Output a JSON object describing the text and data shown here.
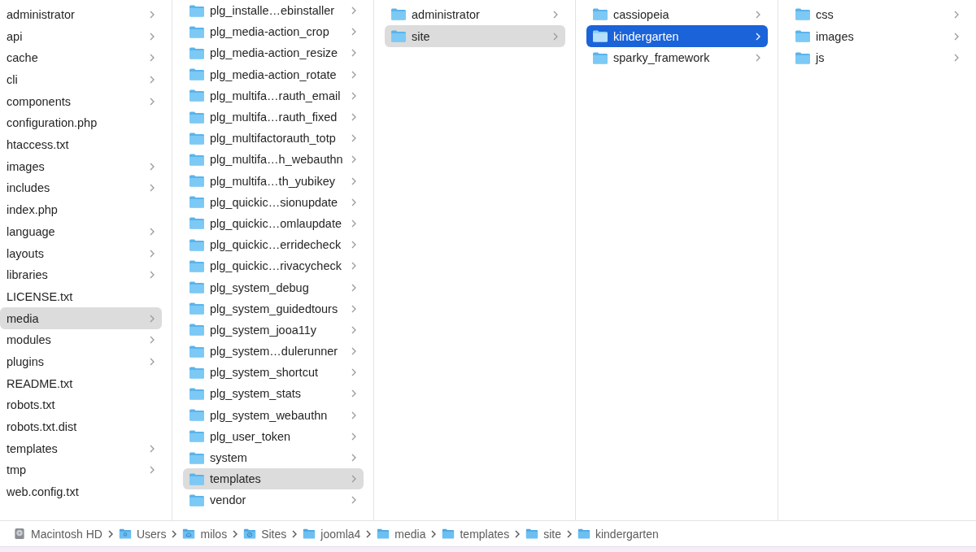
{
  "columns": [
    {
      "show_icons": false,
      "active": false,
      "items": [
        {
          "name": "administrator",
          "kind": "folder",
          "selected": false
        },
        {
          "name": "api",
          "kind": "folder",
          "selected": false
        },
        {
          "name": "cache",
          "kind": "folder",
          "selected": false
        },
        {
          "name": "cli",
          "kind": "folder",
          "selected": false
        },
        {
          "name": "components",
          "kind": "folder",
          "selected": false
        },
        {
          "name": "configuration.php",
          "kind": "file",
          "selected": false
        },
        {
          "name": "htaccess.txt",
          "kind": "file",
          "selected": false
        },
        {
          "name": "images",
          "kind": "folder",
          "selected": false
        },
        {
          "name": "includes",
          "kind": "folder",
          "selected": false
        },
        {
          "name": "index.php",
          "kind": "file",
          "selected": false
        },
        {
          "name": "language",
          "kind": "folder",
          "selected": false
        },
        {
          "name": "layouts",
          "kind": "folder",
          "selected": false
        },
        {
          "name": "libraries",
          "kind": "folder",
          "selected": false
        },
        {
          "name": "LICENSE.txt",
          "kind": "file",
          "selected": false
        },
        {
          "name": "media",
          "kind": "folder",
          "selected": true
        },
        {
          "name": "modules",
          "kind": "folder",
          "selected": false
        },
        {
          "name": "plugins",
          "kind": "folder",
          "selected": false
        },
        {
          "name": "README.txt",
          "kind": "file",
          "selected": false
        },
        {
          "name": "robots.txt",
          "kind": "file",
          "selected": false
        },
        {
          "name": "robots.txt.dist",
          "kind": "file",
          "selected": false
        },
        {
          "name": "templates",
          "kind": "folder",
          "selected": false
        },
        {
          "name": "tmp",
          "kind": "folder",
          "selected": false
        },
        {
          "name": "web.config.txt",
          "kind": "file",
          "selected": false
        }
      ]
    },
    {
      "show_icons": true,
      "active": false,
      "items": [
        {
          "name": "plg_installe…ebinstaller",
          "kind": "folder",
          "selected": false
        },
        {
          "name": "plg_media-action_crop",
          "kind": "folder",
          "selected": false
        },
        {
          "name": "plg_media-action_resize",
          "kind": "folder",
          "selected": false
        },
        {
          "name": "plg_media-action_rotate",
          "kind": "folder",
          "selected": false
        },
        {
          "name": "plg_multifa…rauth_email",
          "kind": "folder",
          "selected": false
        },
        {
          "name": "plg_multifa…rauth_fixed",
          "kind": "folder",
          "selected": false
        },
        {
          "name": "plg_multifactorauth_totp",
          "kind": "folder",
          "selected": false
        },
        {
          "name": "plg_multifa…h_webauthn",
          "kind": "folder",
          "selected": false
        },
        {
          "name": "plg_multifa…th_yubikey",
          "kind": "folder",
          "selected": false
        },
        {
          "name": "plg_quickic…sionupdate",
          "kind": "folder",
          "selected": false
        },
        {
          "name": "plg_quickic…omlaupdate",
          "kind": "folder",
          "selected": false
        },
        {
          "name": "plg_quickic…erridecheck",
          "kind": "folder",
          "selected": false
        },
        {
          "name": "plg_quickic…rivacycheck",
          "kind": "folder",
          "selected": false
        },
        {
          "name": "plg_system_debug",
          "kind": "folder",
          "selected": false
        },
        {
          "name": "plg_system_guidedtours",
          "kind": "folder",
          "selected": false
        },
        {
          "name": "plg_system_jooa11y",
          "kind": "folder",
          "selected": false
        },
        {
          "name": "plg_system…dulerunner",
          "kind": "folder",
          "selected": false
        },
        {
          "name": "plg_system_shortcut",
          "kind": "folder",
          "selected": false
        },
        {
          "name": "plg_system_stats",
          "kind": "folder",
          "selected": false
        },
        {
          "name": "plg_system_webauthn",
          "kind": "folder",
          "selected": false
        },
        {
          "name": "plg_user_token",
          "kind": "folder",
          "selected": false
        },
        {
          "name": "system",
          "kind": "folder",
          "selected": false
        },
        {
          "name": "templates",
          "kind": "folder",
          "selected": true
        },
        {
          "name": "vendor",
          "kind": "folder",
          "selected": false
        }
      ]
    },
    {
      "show_icons": true,
      "active": false,
      "items": [
        {
          "name": "administrator",
          "kind": "folder",
          "selected": false
        },
        {
          "name": "site",
          "kind": "folder",
          "selected": true
        }
      ]
    },
    {
      "show_icons": true,
      "active": true,
      "items": [
        {
          "name": "cassiopeia",
          "kind": "folder",
          "selected": false
        },
        {
          "name": "kindergarten",
          "kind": "folder",
          "selected": true
        },
        {
          "name": "sparky_framework",
          "kind": "folder",
          "selected": false
        }
      ]
    },
    {
      "show_icons": true,
      "items": [
        {
          "name": "css",
          "kind": "folder",
          "selected": false
        },
        {
          "name": "images",
          "kind": "folder",
          "selected": false
        },
        {
          "name": "js",
          "kind": "folder",
          "selected": false
        }
      ]
    }
  ],
  "path_bar": [
    {
      "name": "Macintosh HD",
      "kind": "drive"
    },
    {
      "name": "Users",
      "kind": "users-folder"
    },
    {
      "name": "milos",
      "kind": "home-folder"
    },
    {
      "name": "Sites",
      "kind": "sites-folder"
    },
    {
      "name": "joomla4",
      "kind": "folder"
    },
    {
      "name": "media",
      "kind": "folder"
    },
    {
      "name": "templates",
      "kind": "folder"
    },
    {
      "name": "site",
      "kind": "folder"
    },
    {
      "name": "kindergarten",
      "kind": "folder"
    }
  ]
}
